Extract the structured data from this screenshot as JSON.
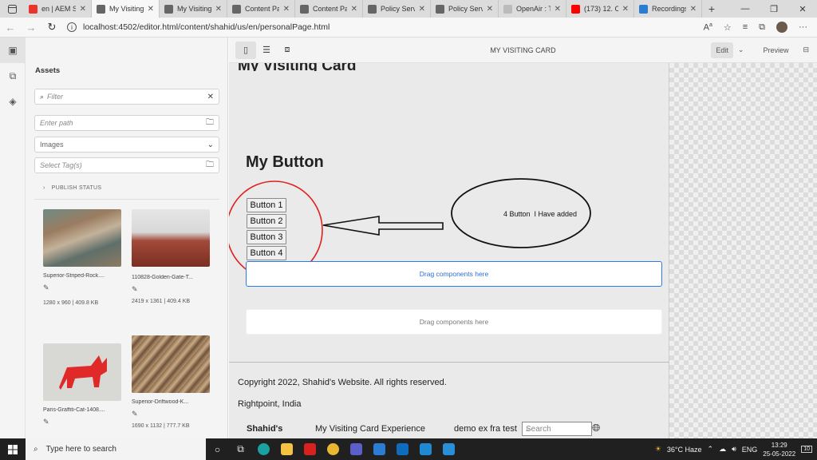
{
  "browser": {
    "tabs": [
      {
        "label": "en | AEM Si",
        "icon_color": "#e8362b",
        "active": false
      },
      {
        "label": "My Visiting",
        "icon_color": "#666666",
        "active": true
      },
      {
        "label": "My Visiting",
        "icon_color": "#666666",
        "active": false
      },
      {
        "label": "Content Pa",
        "icon_color": "#666666",
        "active": false
      },
      {
        "label": "Content Pa",
        "icon_color": "#666666",
        "active": false
      },
      {
        "label": "Policy Servi",
        "icon_color": "#666666",
        "active": false
      },
      {
        "label": "Policy Servi",
        "icon_color": "#666666",
        "active": false
      },
      {
        "label": "OpenAir : T",
        "icon_color": "#bbbbbb",
        "active": false
      },
      {
        "label": "(173) 12. C",
        "icon_color": "#ff0000",
        "active": false
      },
      {
        "label": "Recordings",
        "icon_color": "#2b7cd3",
        "active": false
      }
    ],
    "url": "localhost:4502/editor.html/content/shahid/us/en/personalPage.html"
  },
  "assets_panel": {
    "title": "Assets",
    "filter_placeholder": "Filter",
    "path_placeholder": "Enter path",
    "type_select": "Images",
    "tags_placeholder": "Select Tag(s)",
    "publish_status": "PUBLISH STATUS",
    "cards": [
      {
        "name": "Superior-Striped-Rock....",
        "meta": "1280 x 960 | 409.8 KB"
      },
      {
        "name": "110828-Golden-Gate-T...",
        "meta": "2419 x 1361 | 409.4 KB"
      },
      {
        "name": "Paris-Graffiti-Cat-1408....",
        "meta": ""
      },
      {
        "name": "Superior-Driftwood-K...",
        "meta": "1690 x 1132 | 777.7 KB"
      }
    ]
  },
  "editor_toolbar": {
    "page_name": "MY VISITING CARD",
    "edit_label": "Edit",
    "preview_label": "Preview"
  },
  "page": {
    "top_heading": "My Visiting Card",
    "heading": "My Button",
    "buttons": [
      "Button 1",
      "Button 2",
      "Button 3",
      "Button 4"
    ],
    "drop_zone_1": "Drag components here",
    "drop_zone_2": "Drag components here",
    "annotation": "4 Button  I Have added",
    "copyright": "Copyright 2022, Shahid's Website. All rights reserved.",
    "address": "Rightpoint, India",
    "footer_nav": [
      "Shahid's",
      "My Visiting Card Experience",
      "demo ex fra test"
    ],
    "footer_search": "Search"
  },
  "taskbar": {
    "search_placeholder": "Type here to search",
    "weather": "36°C  Haze",
    "lang": "ENG",
    "time": "13:29",
    "date": "25-05-2022",
    "notif_count": "10"
  }
}
